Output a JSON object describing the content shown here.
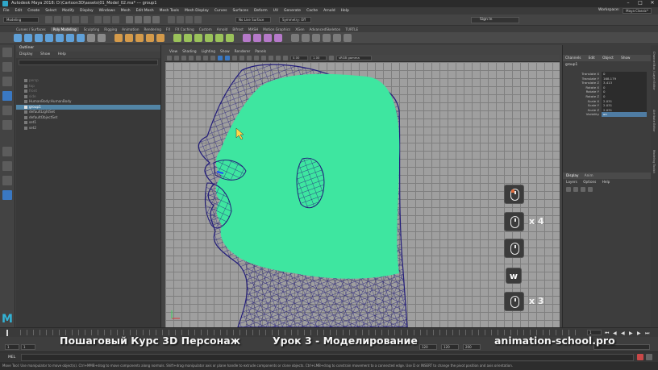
{
  "window": {
    "title": "Autodesk Maya 2018: D:\\Cartoon3D\\assets\\01_Model_02.ma*  ---  group1",
    "workspace_label": "Workspace:",
    "workspace_value": "Maya Classic*",
    "controls": [
      "–",
      "□",
      "✕"
    ]
  },
  "menubar": {
    "items": [
      "File",
      "Edit",
      "Create",
      "Select",
      "Modify",
      "Display",
      "Windows",
      "Mesh",
      "Edit Mesh",
      "Mesh Tools",
      "Mesh Display",
      "Curves",
      "Surfaces",
      "Deform",
      "UV",
      "Generate",
      "Cache",
      "Arnold",
      "Help"
    ]
  },
  "statusline": {
    "mode": "Modeling",
    "live_surface": "No Live Surface",
    "symmetry": "Symmetry: Off",
    "sign_in": "Sign In"
  },
  "shelf": {
    "tabs": [
      "Curves / Surfaces",
      "Poly Modeling",
      "Sculpting",
      "Rigging",
      "Animation",
      "Rendering",
      "FX",
      "FX Caching",
      "Custom",
      "Arnold",
      "Bifrost",
      "MASH",
      "Motion Graphics",
      "XGen",
      "AdvancedSkeleton",
      "TURTLE"
    ],
    "active_tab": "Poly Modeling"
  },
  "outliner": {
    "title": "Outliner",
    "menu": [
      "Display",
      "Show",
      "Help"
    ],
    "items": [
      {
        "label": "persp",
        "dim": true,
        "selected": false
      },
      {
        "label": "top",
        "dim": true,
        "selected": false
      },
      {
        "label": "front",
        "dim": true,
        "selected": false
      },
      {
        "label": "side",
        "dim": true,
        "selected": false
      },
      {
        "label": "HumanBody:HumanBody",
        "dim": false,
        "selected": false
      },
      {
        "label": "group1",
        "dim": false,
        "selected": true
      },
      {
        "label": "defaultLightSet",
        "dim": false,
        "selected": false
      },
      {
        "label": "defaultObjectSet",
        "dim": false,
        "selected": false
      },
      {
        "label": "set1",
        "dim": false,
        "selected": false
      },
      {
        "label": "set2",
        "dim": false,
        "selected": false
      }
    ]
  },
  "viewport": {
    "menu": [
      "View",
      "Shading",
      "Lighting",
      "Show",
      "Renderer",
      "Panels"
    ],
    "near": "0.00",
    "far": "1.00",
    "color_space": "sRGB gamma"
  },
  "overlay": {
    "badges": [
      {
        "type": "mouse-left",
        "label": ""
      },
      {
        "type": "mouse",
        "label": "x 4"
      },
      {
        "type": "mouse",
        "label": ""
      },
      {
        "type": "key",
        "label": "w"
      },
      {
        "type": "mouse",
        "label": "x 3"
      }
    ],
    "course_title": "Пошаговый Курс 3D Персонаж",
    "lesson_title": "Урок 3 - Моделирование",
    "site": "animation-school.pro"
  },
  "channelbox": {
    "tabs": [
      "Channels",
      "Edit",
      "Object",
      "Show"
    ],
    "object_name": "group1",
    "attributes": [
      {
        "name": "Translate X",
        "value": "0"
      },
      {
        "name": "Translate Y",
        "value": "168.179"
      },
      {
        "name": "Translate Z",
        "value": "3.413"
      },
      {
        "name": "Rotate X",
        "value": "0"
      },
      {
        "name": "Rotate Y",
        "value": "0"
      },
      {
        "name": "Rotate Z",
        "value": "0"
      },
      {
        "name": "Scale X",
        "value": "2.031"
      },
      {
        "name": "Scale Y",
        "value": "2.031"
      },
      {
        "name": "Scale Z",
        "value": "2.031"
      },
      {
        "name": "Visibility",
        "value": "on",
        "highlight": true
      }
    ],
    "layer_tabs": [
      "Display",
      "Anim"
    ],
    "layer_menu": [
      "Layers",
      "Options",
      "Help"
    ]
  },
  "sidestrip": [
    "Channel Box / Layer Editor",
    "Attribute Editor",
    "Modeling Toolkit"
  ],
  "timeline": {
    "range_start": "1",
    "range_inner_start": "1",
    "range_inner_end": "120",
    "range_end": "120",
    "range_end2": "200",
    "current": "1"
  },
  "cmdline": {
    "label": "MEL"
  },
  "helpline": {
    "text": "Move Tool: Use manipulator to move object(s). Ctrl+MMB+drag to move components along normals. Shift+drag manipulator axis or plane handle to extrude components or clone objects. Ctrl+LMB+drag to constrain movement to a connected edge. Use D or INSERT to change the pivot position and axis orientation."
  },
  "colors": {
    "accent": "#3a78c2",
    "selection": "#5285a6",
    "mesh_fill": "#3ee6a0",
    "wire": "#221c7a",
    "maya_logo": "#33b3d6"
  }
}
